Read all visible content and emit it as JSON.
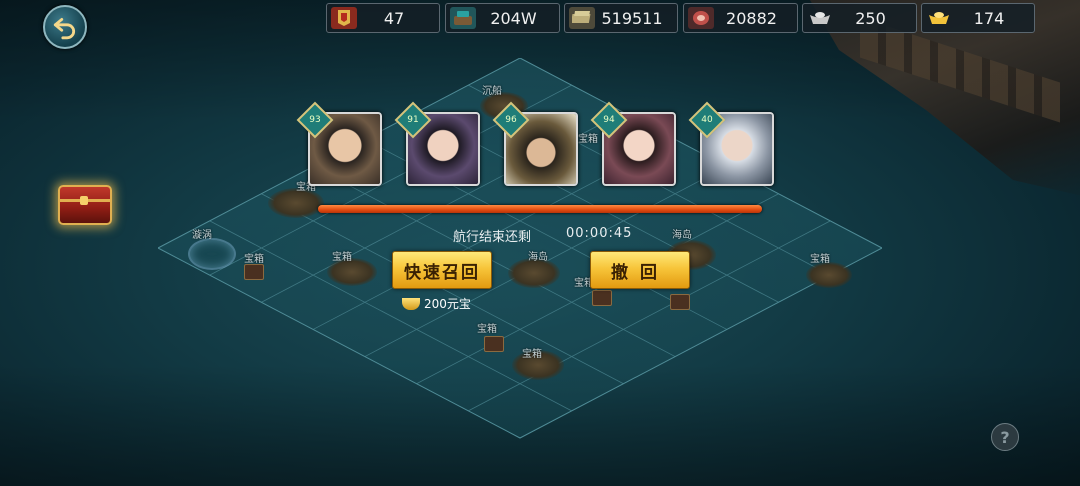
{
  "resources": [
    {
      "icon": "banner-token-icon",
      "value": "47",
      "color": "#c0392b"
    },
    {
      "icon": "wood-barrel-icon",
      "value": "204W",
      "color": "#2aa1a0"
    },
    {
      "icon": "silver-stack-icon",
      "value": "519511",
      "color": "#a89a6a"
    },
    {
      "icon": "meat-icon",
      "value": "20882",
      "color": "#c0504a"
    },
    {
      "icon": "silver-ingot-icon",
      "value": "250",
      "color": "#c8c8c8"
    },
    {
      "icon": "gold-ingot-icon",
      "value": "174",
      "color": "#f2c23a"
    }
  ],
  "heroes": [
    {
      "level": "93",
      "color": "#6f5a45"
    },
    {
      "level": "91",
      "color": "#5b4a6e"
    },
    {
      "level": "96",
      "color": "#6a5a3c"
    },
    {
      "level": "94",
      "color": "#7a4a55"
    },
    {
      "level": "40",
      "color": "#8c96a4"
    }
  ],
  "voyage": {
    "remaining_label": "航行结束还剩",
    "remaining_time": "00:00:45",
    "progress": 1.0
  },
  "buttons": {
    "quick_recall": "快速召回",
    "withdraw": "撤回",
    "cost": "200元宝"
  },
  "map_labels": [
    "漩涡",
    "宝箱",
    "宝箱",
    "宝箱",
    "宝箱",
    "海岛",
    "宝箱",
    "宝箱",
    "海岛",
    "宝箱",
    "宝箱",
    "沉船"
  ],
  "help": "?",
  "colors": {
    "accent_gold": "#f7c53a",
    "progress": "#e24b10",
    "level_badge": "#1f7d78"
  }
}
